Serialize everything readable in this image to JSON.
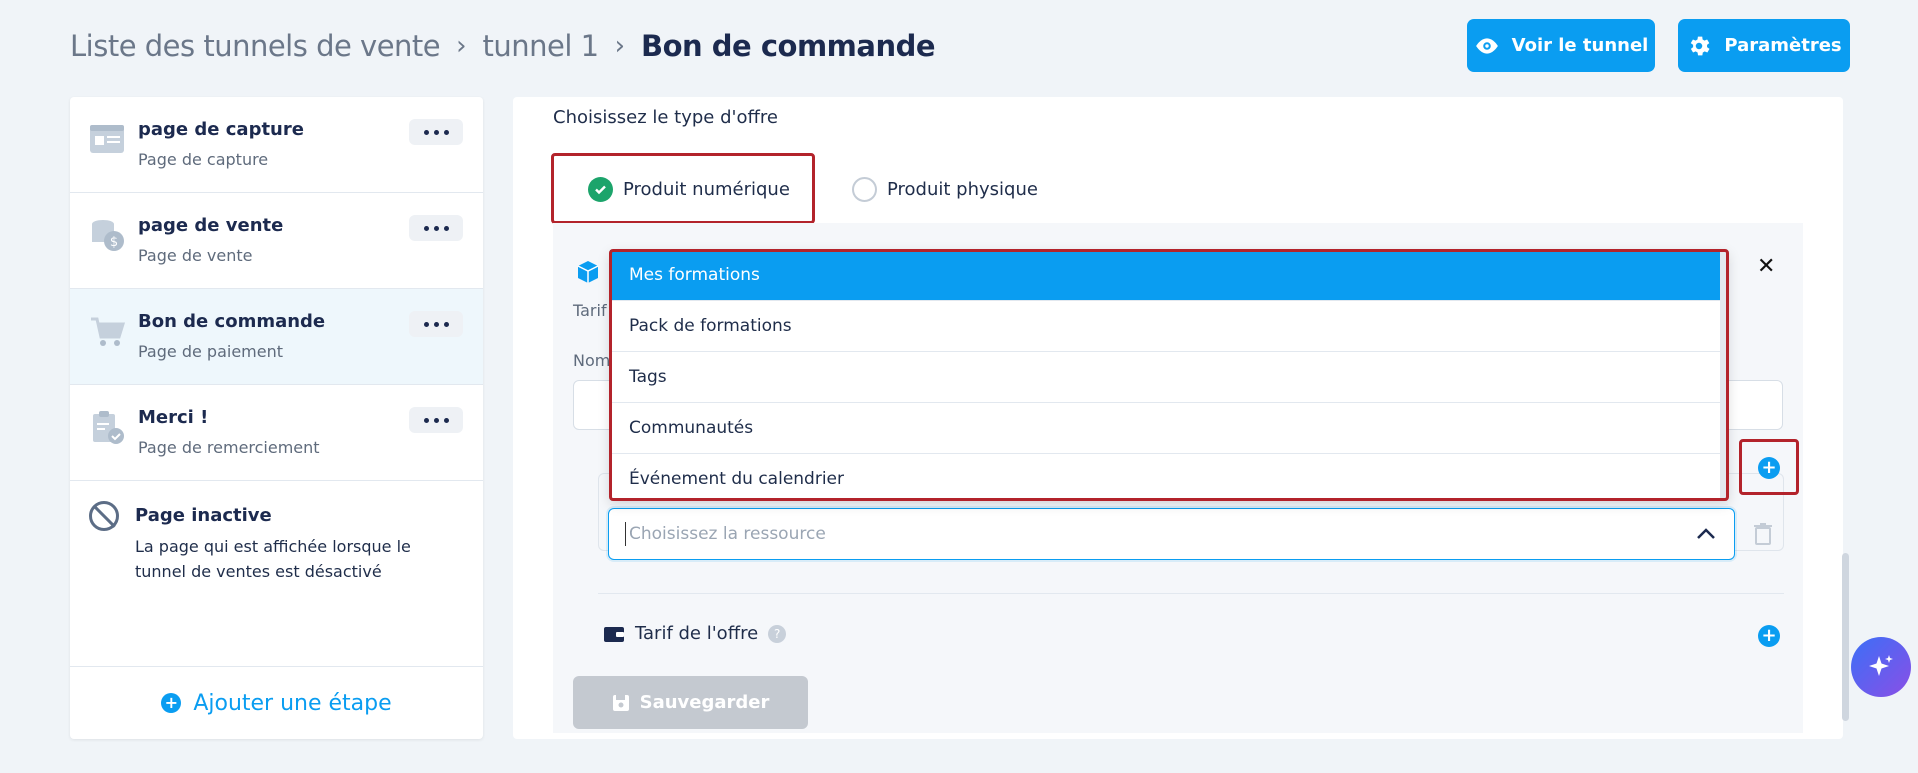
{
  "breadcrumb": {
    "items": [
      "Liste des tunnels de vente",
      "tunnel 1"
    ],
    "current": "Bon de commande"
  },
  "header_buttons": {
    "view_label": "Voir le tunnel",
    "settings_label": "Paramètres"
  },
  "sidebar": {
    "steps": [
      {
        "title": "page de capture",
        "subtitle": "Page de capture",
        "icon": "capture-page-icon"
      },
      {
        "title": "page de vente",
        "subtitle": "Page de vente",
        "icon": "sales-page-icon"
      },
      {
        "title": "Bon de commande",
        "subtitle": "Page de paiement",
        "icon": "cart-icon",
        "active": true
      },
      {
        "title": "Merci !",
        "subtitle": "Page de remerciement",
        "icon": "thank-you-clipboard-icon"
      }
    ],
    "inactive": {
      "title": "Page inactive",
      "description": "La page qui est affichée lorsque le tunnel de ventes est désactivé"
    },
    "add_step_label": "Ajouter une étape"
  },
  "offer": {
    "label": "Choisissez le type d'offre",
    "options": [
      "Produit numérique",
      "Produit physique"
    ],
    "selected": "Produit numérique"
  },
  "panel": {
    "partial_label_1": "Tarif",
    "partial_label_2": "Nom",
    "resource_placeholder": "Choisissez la ressource",
    "tarif_label": "Tarif de l'offre",
    "save_label": "Sauvegarder"
  },
  "dropdown": {
    "options": [
      "Mes formations",
      "Pack de formations",
      "Tags",
      "Communautés",
      "Événement du calendrier"
    ],
    "selected": "Mes formations"
  },
  "colors": {
    "accent": "#0a9df1",
    "highlight": "#b3232b",
    "success": "#1ca46b"
  }
}
